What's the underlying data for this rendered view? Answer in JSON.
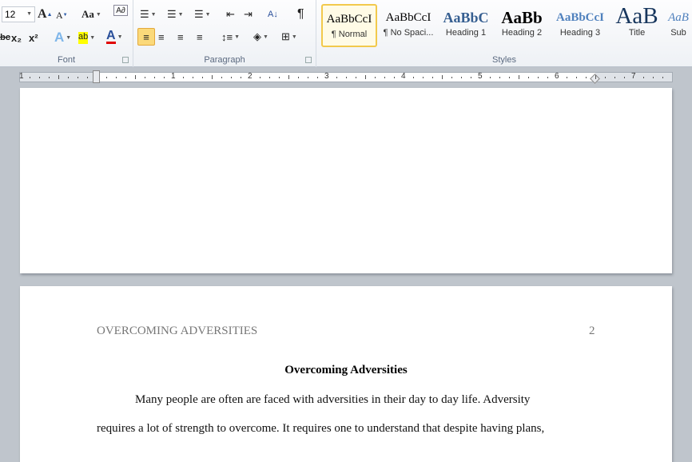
{
  "ribbon": {
    "font": {
      "label": "Font",
      "size": "12",
      "grow": "A",
      "shrink": "A",
      "case": "Aa",
      "strike": "abc",
      "subscript": "x₂",
      "superscript": "x²",
      "effects": "A",
      "highlight": "ab",
      "highlight_color": "#ffff00",
      "font_color": "A",
      "font_color_value": "#e00000"
    },
    "paragraph": {
      "label": "Paragraph",
      "pilcrow": "¶",
      "sort": "A↓"
    },
    "styles": {
      "label": "Styles",
      "items": [
        {
          "preview": "AaBbCcI",
          "name": "¶ Normal",
          "selected": true
        },
        {
          "preview": "AaBbCcI",
          "name": "¶ No Spaci..."
        },
        {
          "preview": "AaBbC",
          "name": "Heading 1"
        },
        {
          "preview": "AaBb",
          "name": "Heading 2"
        },
        {
          "preview": "AaBbCcI",
          "name": "Heading 3"
        },
        {
          "preview": "AaB",
          "name": "Title"
        },
        {
          "preview": "AaB",
          "name": "Sub"
        }
      ]
    }
  },
  "ruler": {
    "numbers": [
      "1",
      "1",
      "2",
      "3",
      "4",
      "5",
      "6",
      "7"
    ]
  },
  "document": {
    "page2": {
      "header_title": "OVERCOMING ADVERSITIES",
      "page_number": "2",
      "title": "Overcoming Adversities",
      "lines": [
        "Many people are often are faced with adversities in their day to day life. Adversity",
        "requires  a lot of strength to overcome. It requires one to understand that despite having plans,"
      ]
    }
  }
}
